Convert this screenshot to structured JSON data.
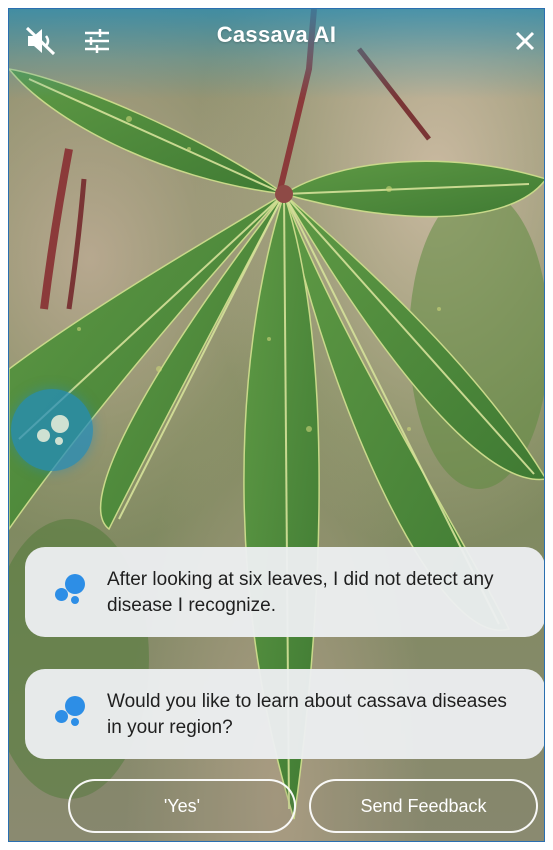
{
  "header": {
    "title": "Cassava AI",
    "mute_icon": "speaker-muted-icon",
    "settings_icon": "sliders-icon",
    "close_icon": "close-icon"
  },
  "assistant": {
    "orb_icon": "assistant-dots-icon"
  },
  "messages": [
    {
      "icon": "assistant-bubbles-icon",
      "text": "After looking at six leaves, I did not detect any disease I recognize."
    },
    {
      "icon": "assistant-bubbles-icon",
      "text": "Would you like to learn about cassava diseases in your region?"
    }
  ],
  "actions": {
    "yes_label": "'Yes'",
    "feedback_label": "Send Feedback"
  },
  "colors": {
    "accent_blue": "#2d8ee6",
    "header_tint": "#288cb4",
    "card_bg": "#eceef0",
    "leaf_green": "#4f8a3a"
  }
}
